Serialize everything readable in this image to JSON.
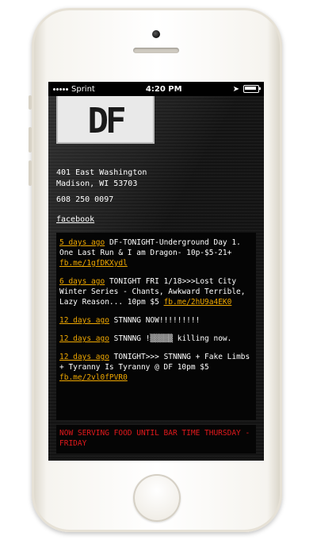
{
  "status_bar": {
    "carrier": "Sprint",
    "time": "4:20 PM"
  },
  "logo": {
    "text": "DF"
  },
  "address": {
    "line1": "401 East Washington",
    "line2": "Madison, WI 53703"
  },
  "phone": "608 250 0097",
  "facebook_link": "facebook",
  "posts": [
    {
      "time": "5 days ago",
      "text": "DF-TONIGHT-Underground Day 1. One Last Run & I am Dragon- 10p-$5-21+ ",
      "link": "fb.me/1gfDKXydl"
    },
    {
      "time": "6 days ago",
      "text": "TONIGHT FRI 1/18>>>Lost City Winter Series - Chants, Awkward Terrible, Lazy Reason... 10pm $5 ",
      "link": "fb.me/2hU9a4EK0"
    },
    {
      "time": "12 days ago",
      "text": "STNNNG NOW!!!!!!!!!",
      "link": ""
    },
    {
      "time": "12 days ago",
      "text": "STNNNG !▒▒▒▒▒ killing now.",
      "link": ""
    },
    {
      "time": "12 days ago",
      "text": "TONIGHT>>> STNNNG + Fake Limbs + Tyranny Is Tyranny @ DF 10pm $5 ",
      "link": "fb.me/2vl0fPVR0"
    }
  ],
  "notice": "NOW SERVING FOOD UNTIL BAR TIME THURSDAY - FRIDAY",
  "icons": [
    "signal-icon",
    "location-icon",
    "battery-icon",
    "camera-icon",
    "home-button-icon"
  ],
  "colors": {
    "link": "#f0a800",
    "notice": "#e3191c",
    "background": "#000000"
  }
}
